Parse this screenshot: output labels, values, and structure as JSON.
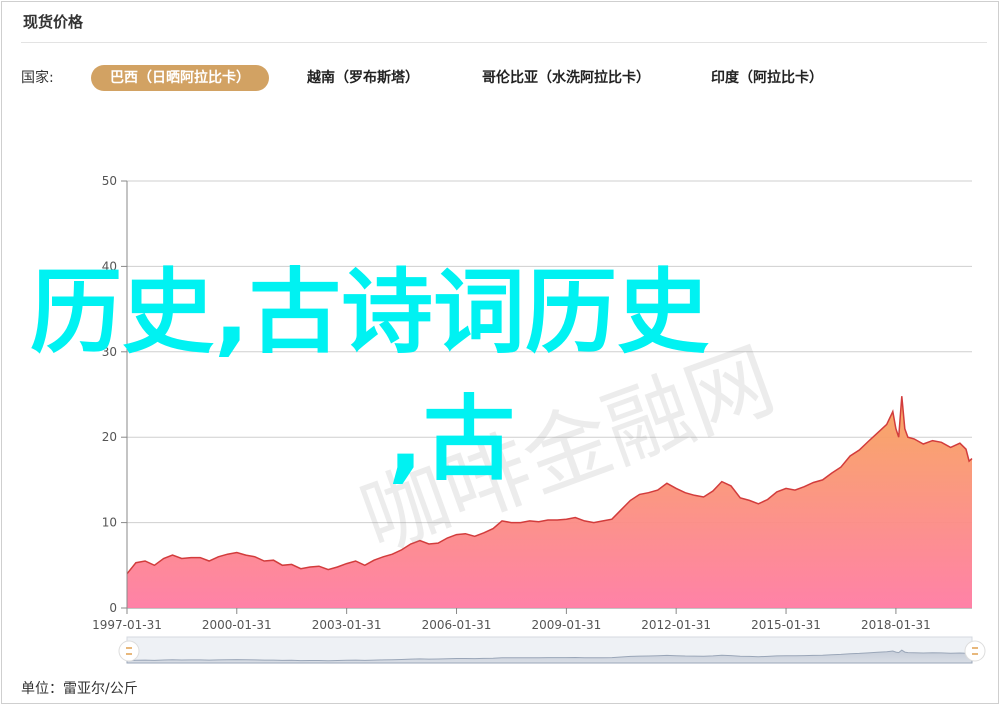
{
  "panel": {
    "title": "现货价格"
  },
  "filter": {
    "label": "国家:",
    "tabs": [
      {
        "label": "巴西（日晒阿拉比卡）",
        "active": true
      },
      {
        "label": "越南（罗布斯塔）",
        "active": false
      },
      {
        "label": "哥伦比亚（水洗阿拉比卡）",
        "active": false
      },
      {
        "label": "印度（阿拉比卡）",
        "active": false
      }
    ]
  },
  "footer": {
    "unit": "单位：雷亚尔/公斤"
  },
  "overlay": {
    "line1": "历史,古诗词历史",
    "line2": ",古"
  },
  "watermark": {
    "text": "咖啡金融网"
  },
  "colors": {
    "accent": "#d2a263",
    "line": "#d23c3c",
    "areaTop": "#f7a55a",
    "areaBottom": "#ff7ba3",
    "overlay": "#00f2f2"
  },
  "chart_data": {
    "type": "area",
    "title": "",
    "xlabel": "",
    "ylabel": "",
    "ylim": [
      0,
      50
    ],
    "yticks": [
      0,
      10,
      20,
      30,
      40,
      50
    ],
    "xticks": [
      "1997-01-31",
      "2000-01-31",
      "2003-01-31",
      "2006-01-31",
      "2009-01-31",
      "2012-01-31",
      "2015-01-31",
      "2018-01-31"
    ],
    "xrange": [
      "1997-01-31",
      "2020-02-29"
    ],
    "grid": true,
    "series": [
      {
        "values": [
          [
            "1997-01-31",
            4.0
          ],
          [
            "1997-04-30",
            5.3
          ],
          [
            "1997-07-31",
            5.5
          ],
          [
            "1997-10-31",
            5.0
          ],
          [
            "1998-01-31",
            5.8
          ],
          [
            "1998-04-30",
            6.2
          ],
          [
            "1998-07-31",
            5.8
          ],
          [
            "1998-10-31",
            5.9
          ],
          [
            "1999-01-31",
            5.9
          ],
          [
            "1999-04-30",
            5.5
          ],
          [
            "1999-07-31",
            6.0
          ],
          [
            "1999-10-31",
            6.3
          ],
          [
            "2000-01-31",
            6.5
          ],
          [
            "2000-04-30",
            6.2
          ],
          [
            "2000-07-31",
            6.0
          ],
          [
            "2000-10-31",
            5.5
          ],
          [
            "2001-01-31",
            5.6
          ],
          [
            "2001-04-30",
            5.0
          ],
          [
            "2001-07-31",
            5.1
          ],
          [
            "2001-10-31",
            4.6
          ],
          [
            "2002-01-31",
            4.8
          ],
          [
            "2002-04-30",
            4.9
          ],
          [
            "2002-07-31",
            4.5
          ],
          [
            "2002-10-31",
            4.8
          ],
          [
            "2003-01-31",
            5.2
          ],
          [
            "2003-04-30",
            5.5
          ],
          [
            "2003-07-31",
            5.0
          ],
          [
            "2003-10-31",
            5.6
          ],
          [
            "2004-01-31",
            6.0
          ],
          [
            "2004-04-30",
            6.3
          ],
          [
            "2004-07-31",
            6.8
          ],
          [
            "2004-10-31",
            7.5
          ],
          [
            "2005-01-31",
            7.9
          ],
          [
            "2005-04-30",
            7.5
          ],
          [
            "2005-07-31",
            7.6
          ],
          [
            "2005-10-31",
            8.2
          ],
          [
            "2006-01-31",
            8.6
          ],
          [
            "2006-04-30",
            8.7
          ],
          [
            "2006-07-31",
            8.4
          ],
          [
            "2006-10-31",
            8.8
          ],
          [
            "2007-01-31",
            9.3
          ],
          [
            "2007-04-30",
            10.2
          ],
          [
            "2007-07-31",
            10.0
          ],
          [
            "2007-10-31",
            10.0
          ],
          [
            "2008-01-31",
            10.2
          ],
          [
            "2008-04-30",
            10.1
          ],
          [
            "2008-07-31",
            10.3
          ],
          [
            "2008-10-31",
            10.3
          ],
          [
            "2009-01-31",
            10.4
          ],
          [
            "2009-04-30",
            10.6
          ],
          [
            "2009-07-31",
            10.2
          ],
          [
            "2009-10-31",
            10.0
          ],
          [
            "2010-01-31",
            10.2
          ],
          [
            "2010-04-30",
            10.4
          ],
          [
            "2010-07-31",
            11.5
          ],
          [
            "2010-10-31",
            12.6
          ],
          [
            "2011-01-31",
            13.3
          ],
          [
            "2011-04-30",
            13.5
          ],
          [
            "2011-07-31",
            13.8
          ],
          [
            "2011-10-31",
            14.6
          ],
          [
            "2012-01-31",
            14.0
          ],
          [
            "2012-04-30",
            13.5
          ],
          [
            "2012-07-31",
            13.2
          ],
          [
            "2012-10-31",
            13.0
          ],
          [
            "2013-01-31",
            13.7
          ],
          [
            "2013-04-30",
            14.8
          ],
          [
            "2013-07-31",
            14.3
          ],
          [
            "2013-10-31",
            12.9
          ],
          [
            "2014-01-31",
            12.6
          ],
          [
            "2014-04-30",
            12.2
          ],
          [
            "2014-07-31",
            12.7
          ],
          [
            "2014-10-31",
            13.6
          ],
          [
            "2015-01-31",
            14.0
          ],
          [
            "2015-04-30",
            13.8
          ],
          [
            "2015-07-31",
            14.2
          ],
          [
            "2015-10-31",
            14.7
          ],
          [
            "2016-01-31",
            15.0
          ],
          [
            "2016-04-30",
            15.8
          ],
          [
            "2016-07-31",
            16.5
          ],
          [
            "2016-10-31",
            17.8
          ],
          [
            "2017-01-31",
            18.5
          ],
          [
            "2017-04-30",
            19.5
          ],
          [
            "2017-07-31",
            20.5
          ],
          [
            "2017-10-31",
            21.5
          ],
          [
            "2017-12-31",
            23.0
          ],
          [
            "2018-01-31",
            21.0
          ],
          [
            "2018-02-28",
            20.0
          ],
          [
            "2018-03-31",
            24.8
          ],
          [
            "2018-04-30",
            21.0
          ],
          [
            "2018-05-31",
            20.0
          ],
          [
            "2018-07-31",
            19.8
          ],
          [
            "2018-10-31",
            19.2
          ],
          [
            "2019-01-31",
            19.6
          ],
          [
            "2019-04-30",
            19.4
          ],
          [
            "2019-07-31",
            18.8
          ],
          [
            "2019-10-31",
            19.3
          ],
          [
            "2019-12-31",
            18.6
          ],
          [
            "2020-01-31",
            17.2
          ],
          [
            "2020-02-29",
            17.5
          ]
        ]
      }
    ]
  }
}
